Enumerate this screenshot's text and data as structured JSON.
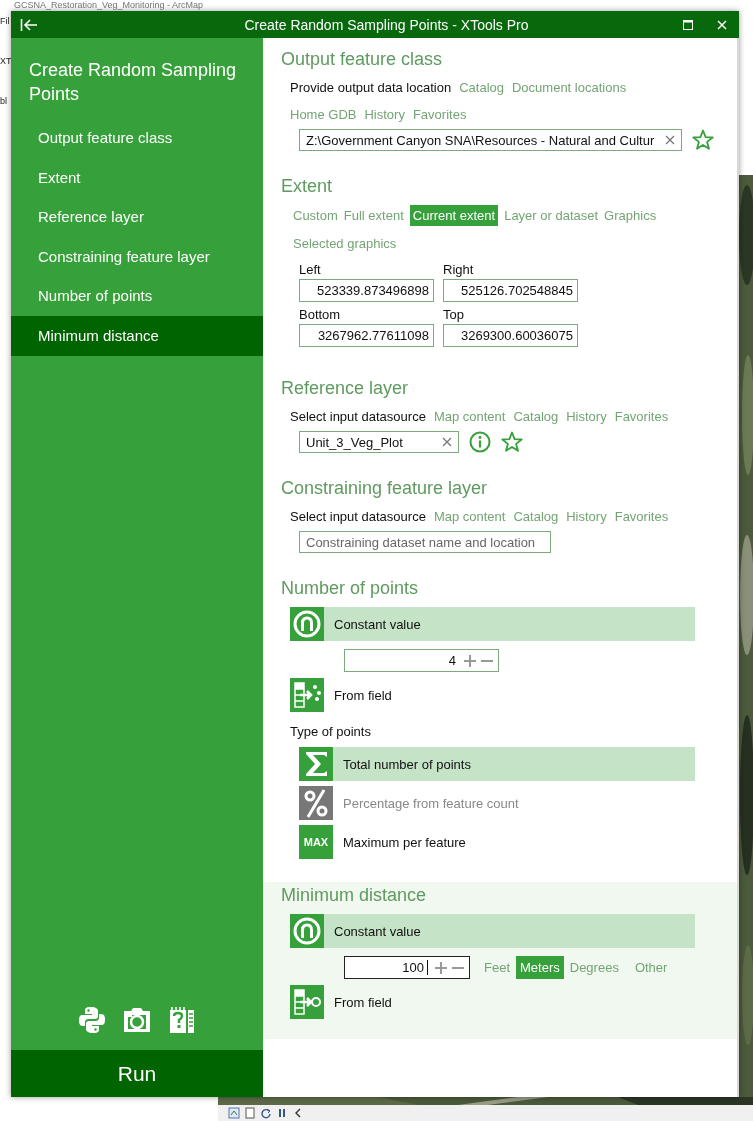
{
  "background": {
    "title": "GCSNA_Restoration_Veg_Monitoring - ArcMap",
    "fragments": [
      "Fil",
      "XT",
      "bl"
    ]
  },
  "window": {
    "title": "Create Random Sampling Points - XTools Pro"
  },
  "sidebar": {
    "title": "Create Random Sampling Points",
    "items": [
      {
        "label": "Output feature class",
        "selected": false
      },
      {
        "label": "Extent",
        "selected": false
      },
      {
        "label": "Reference layer",
        "selected": false
      },
      {
        "label": "Constraining feature layer",
        "selected": false
      },
      {
        "label": "Number of points",
        "selected": false
      },
      {
        "label": "Minimum distance",
        "selected": true
      }
    ],
    "run_button": "Run"
  },
  "sections": [
    {
      "kind": "output",
      "heading": "Output feature class",
      "prompt": "Provide output data location",
      "links": [
        "Catalog",
        "Document locations",
        "Home GDB",
        "History",
        "Favorites"
      ],
      "value": "Z:\\Government Canyon SNA\\Resources - Natural and Cultur"
    },
    {
      "kind": "extent",
      "heading": "Extent",
      "options": [
        {
          "label": "Custom",
          "selected": false
        },
        {
          "label": "Full extent",
          "selected": false
        },
        {
          "label": "Current extent",
          "selected": true
        },
        {
          "label": "Layer or dataset",
          "selected": false
        },
        {
          "label": "Graphics",
          "selected": false
        },
        {
          "label": "Selected graphics",
          "selected": false
        }
      ],
      "fields": [
        {
          "label": "Left",
          "value": "523339.873496898"
        },
        {
          "label": "Right",
          "value": "525126.702548845"
        },
        {
          "label": "Bottom",
          "value": "3267962.77611098"
        },
        {
          "label": "Top",
          "value": "3269300.60036075"
        }
      ]
    },
    {
      "kind": "datasource",
      "heading": "Reference layer",
      "prompt": "Select input datasource",
      "links": [
        "Map content",
        "Catalog",
        "History",
        "Favorites"
      ],
      "value": "Unit_3_Veg_Plot"
    },
    {
      "kind": "datasource",
      "heading": "Constraining feature layer",
      "prompt": "Select input datasource",
      "links": [
        "Map content",
        "Catalog",
        "History",
        "Favorites"
      ],
      "placeholder": "Constraining dataset name and location"
    },
    {
      "kind": "points",
      "heading": "Number of points",
      "modes": [
        {
          "label": "Constant value",
          "selected": true
        },
        {
          "label": "From field",
          "selected": false
        }
      ],
      "value": "4",
      "types_label": "Type of points",
      "types": [
        {
          "label": "Total number of points",
          "selected": true,
          "disabled": false
        },
        {
          "label": "Percentage from feature count",
          "selected": false,
          "disabled": true
        },
        {
          "label": "Maximum per feature",
          "selected": false,
          "disabled": false,
          "badge": "MAX"
        }
      ]
    },
    {
      "kind": "distance",
      "heading": "Minimum distance",
      "modes": [
        {
          "label": "Constant value",
          "selected": true
        },
        {
          "label": "From field",
          "selected": false
        }
      ],
      "value": "100",
      "units": [
        {
          "label": "Feet",
          "selected": false
        },
        {
          "label": "Meters",
          "selected": true
        },
        {
          "label": "Degrees",
          "selected": false
        },
        {
          "label": "Other",
          "selected": false
        }
      ]
    }
  ]
}
